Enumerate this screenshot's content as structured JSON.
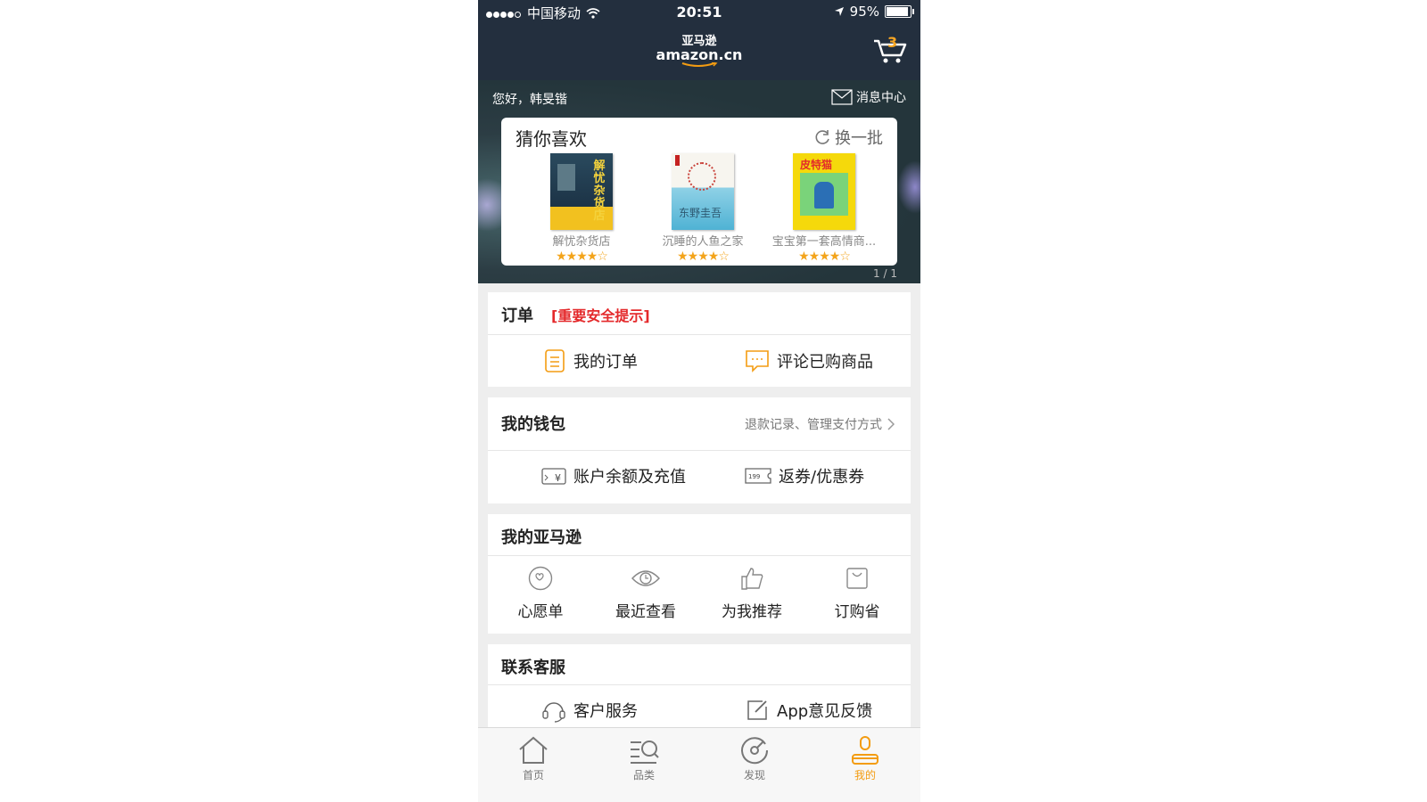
{
  "status_bar": {
    "carrier": "中国移动",
    "time": "20:51",
    "battery": "95%"
  },
  "header": {
    "logo_cn": "亚马逊",
    "logo_en": "amazon.cn",
    "cart_count": "3"
  },
  "hero": {
    "greeting": "您好，韩旻锴",
    "messages": "消息中心",
    "recommend": {
      "title": "猜你喜欢",
      "refresh": "换一批",
      "pager": "1 / 1",
      "books": [
        {
          "name": "解忧杂货店",
          "cover_text": "解忧杂货店",
          "rating": 4.5
        },
        {
          "name": "沉睡的人鱼之家",
          "cover_text": "东野圭吾",
          "rating": 4.5
        },
        {
          "name": "宝宝第一套高情商...",
          "cover_text": "皮特猫",
          "rating": 4.5
        }
      ]
    }
  },
  "orders": {
    "title": "订单",
    "alert": "[重要安全提示]",
    "my_orders": "我的订单",
    "review": "评论已购商品"
  },
  "wallet": {
    "title": "我的钱包",
    "link": "退款记录、管理支付方式",
    "balance": "账户余额及充值",
    "coupon": "返券/优惠券"
  },
  "my_amazon": {
    "title": "我的亚马逊",
    "items": [
      "心愿单",
      "最近查看",
      "为我推荐",
      "订购省"
    ]
  },
  "service": {
    "title": "联系客服",
    "customer": "客户服务",
    "feedback": "App意见反馈"
  },
  "tabbar": {
    "tabs": [
      "首页",
      "品类",
      "发现",
      "我的"
    ],
    "active_color": "#f39c12"
  },
  "colors": {
    "header_bg": "#232f3e",
    "accent": "#f39c12",
    "alert": "#e4292b"
  }
}
